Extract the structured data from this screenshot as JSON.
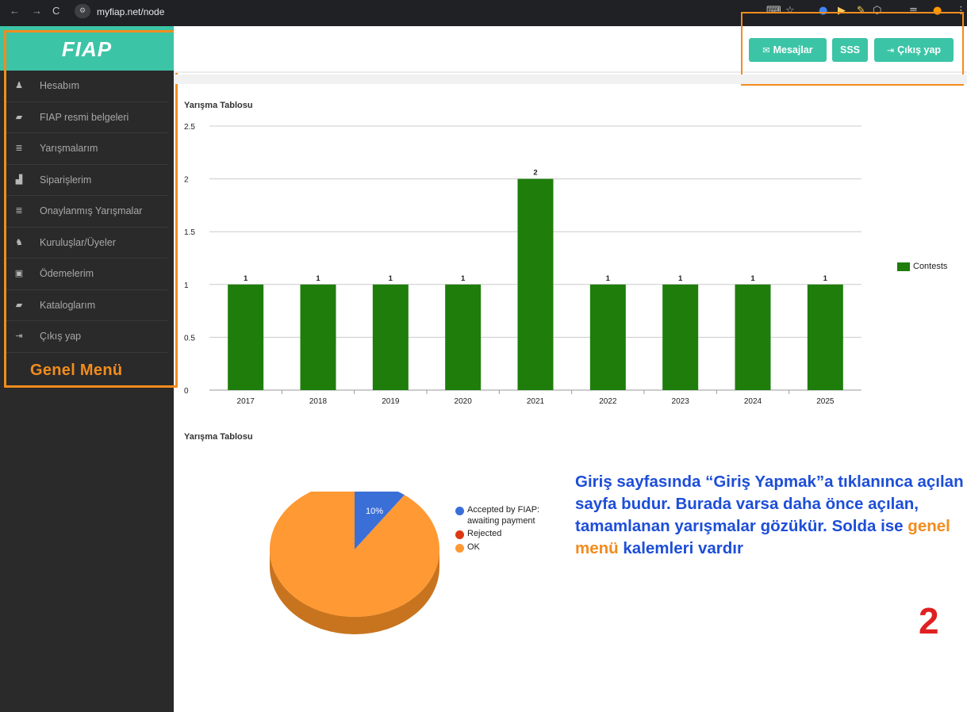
{
  "browser": {
    "url": "myfiap.net/node",
    "nav": {
      "back": "←",
      "forward": "→",
      "reload": "C"
    }
  },
  "app": {
    "logo": "FIAP"
  },
  "sidebar": {
    "items": [
      {
        "label": "Hesabım",
        "icon": "user-icon",
        "glyph": "♟"
      },
      {
        "label": "FIAP resmi belgeleri",
        "icon": "folder-icon",
        "glyph": "▰"
      },
      {
        "label": "Yarışmalarım",
        "icon": "list-icon",
        "glyph": "≣"
      },
      {
        "label": "Siparişlerim",
        "icon": "bar-chart-icon",
        "glyph": "▟"
      },
      {
        "label": "Onaylanmış Yarışmalar",
        "icon": "list-icon",
        "glyph": "≣"
      },
      {
        "label": "Kuruluşlar/Üyeler",
        "icon": "users-icon",
        "glyph": "♞"
      },
      {
        "label": "Ödemelerim",
        "icon": "money-icon",
        "glyph": "▣"
      },
      {
        "label": "Kataloglarım",
        "icon": "folder-icon",
        "glyph": "▰"
      },
      {
        "label": "Çıkış yap",
        "icon": "sign-out-icon",
        "glyph": "⇥"
      }
    ],
    "annotation_label": "Genel Menü"
  },
  "topbar": {
    "messages_label": "Mesajlar",
    "faq_label": "SSS",
    "logout_label": "Çıkış yap"
  },
  "colors": {
    "accent": "#3cc4a6",
    "annotation_orange": "#f28c1e",
    "annotation_blue": "#1d4ed8",
    "bar_green": "#1e7d0b",
    "pie_blue": "#3b6fd8",
    "pie_red": "#dc3912",
    "pie_orange": "#ff9933"
  },
  "chart_data": [
    {
      "type": "bar",
      "title": "Yarışma Tablosu",
      "categories": [
        "2017",
        "2018",
        "2019",
        "2020",
        "2021",
        "2022",
        "2023",
        "2024",
        "2025"
      ],
      "series": [
        {
          "name": "Contests",
          "values": [
            1,
            1,
            1,
            1,
            2,
            1,
            1,
            1,
            1
          ]
        }
      ],
      "yticks": [
        "0",
        "0.5",
        "1",
        "1.5",
        "2",
        "2.5"
      ],
      "ylim": [
        0,
        2.5
      ],
      "grid": true,
      "legend": "right"
    },
    {
      "type": "pie",
      "title": "Yarışma Tablosu",
      "labels": [
        "Accepted by FIAP: awaiting payment",
        "Rejected",
        "OK"
      ],
      "values": [
        10,
        0,
        90
      ],
      "slice_label": "10%",
      "legend": "right"
    }
  ],
  "annotation": {
    "part1": "Giriş sayfasında “Giriş Yapmak”a tıklanınca açılan sayfa budur. Burada varsa daha önce açılan, tamamlanan yarışmalar gözükür. Solda ise",
    "highlight": "genel menü",
    "part2": "kalemleri vardır",
    "step": "2"
  }
}
